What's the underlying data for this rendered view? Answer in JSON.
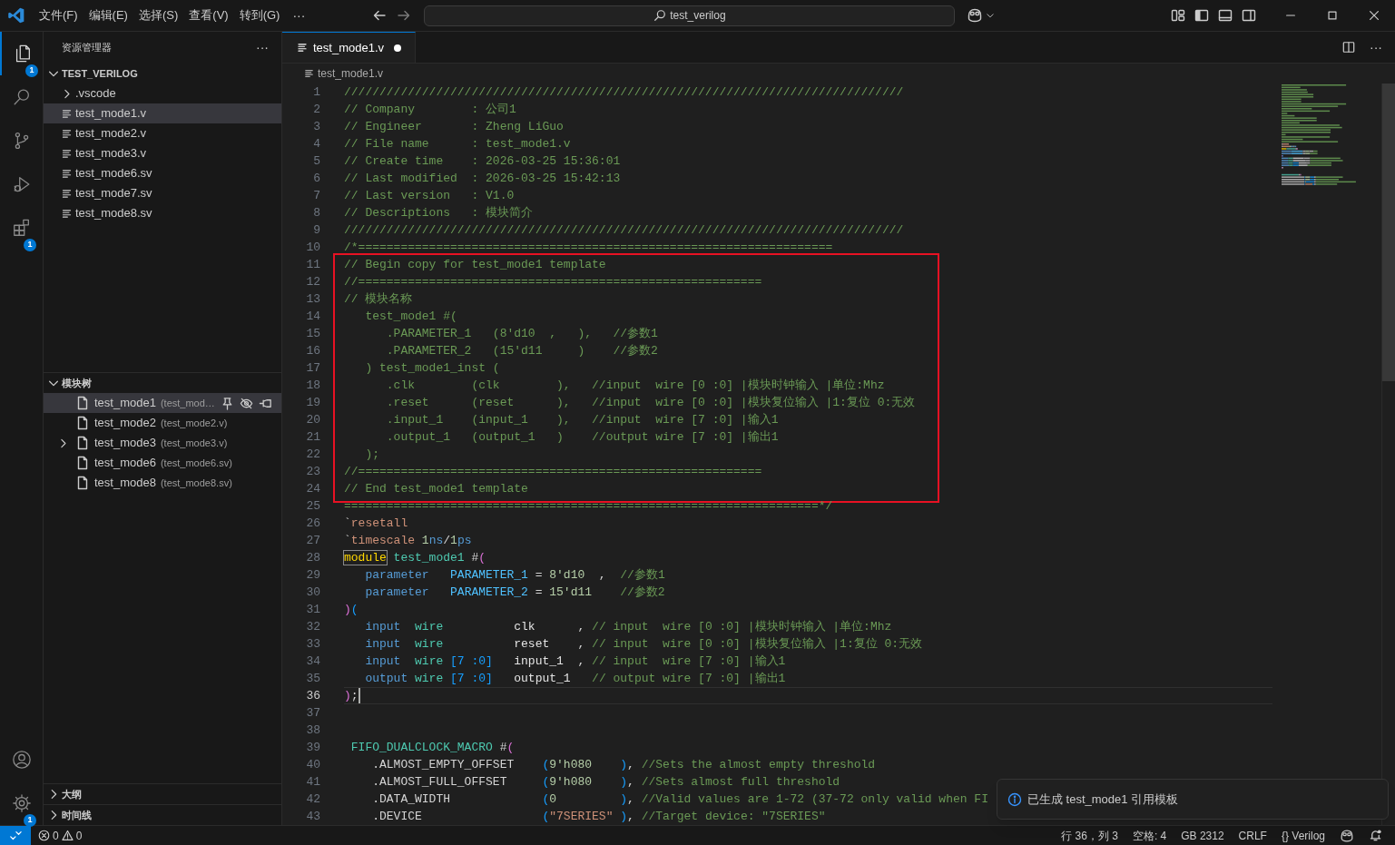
{
  "title_bar": {
    "menus": [
      {
        "label": "文件(F)"
      },
      {
        "label": "编辑(E)"
      },
      {
        "label": "选择(S)"
      },
      {
        "label": "查看(V)"
      },
      {
        "label": "转到(G)"
      }
    ],
    "overflow": "···",
    "search": {
      "value": "test_verilog"
    }
  },
  "activity_bar": {
    "items": [
      {
        "kind": "explorer",
        "selected": true,
        "badge": "1"
      },
      {
        "kind": "search",
        "selected": false
      },
      {
        "kind": "source-control",
        "selected": false
      },
      {
        "kind": "run-debug",
        "selected": false
      },
      {
        "kind": "extensions",
        "selected": false,
        "badge": "1"
      }
    ],
    "bottom": [
      {
        "kind": "account"
      },
      {
        "kind": "settings",
        "badge": "1"
      }
    ]
  },
  "explorer": {
    "title": "资源管理器",
    "overflow": "···",
    "folder": {
      "name": "TEST_VERILOG",
      "expanded": true,
      "children": [
        {
          "kind": "folder",
          "name": ".vscode",
          "expanded": false,
          "selected": false
        },
        {
          "kind": "file",
          "name": "test_mode1.v",
          "selected": true
        },
        {
          "kind": "file",
          "name": "test_mode2.v",
          "selected": false
        },
        {
          "kind": "file",
          "name": "test_mode3.v",
          "selected": false
        },
        {
          "kind": "file",
          "name": "test_mode6.sv",
          "selected": false
        },
        {
          "kind": "file",
          "name": "test_mode7.sv",
          "selected": false
        },
        {
          "kind": "file",
          "name": "test_mode8.sv",
          "selected": false
        }
      ]
    }
  },
  "module_tree": {
    "title": "模块树",
    "expanded": true,
    "items": [
      {
        "name": "test_mode1",
        "file": "(test_mod…",
        "selected": true,
        "expandable": false
      },
      {
        "name": "test_mode2",
        "file": "(test_mode2.v)",
        "selected": false,
        "expandable": false
      },
      {
        "name": "test_mode3",
        "file": "(test_mode3.v)",
        "selected": false,
        "expandable": true
      },
      {
        "name": "test_mode6",
        "file": "(test_mode6.sv)",
        "selected": false,
        "expandable": false
      },
      {
        "name": "test_mode8",
        "file": "(test_mode8.sv)",
        "selected": false,
        "expandable": false
      }
    ]
  },
  "outline": {
    "title": "大纲",
    "expanded": false
  },
  "timeline": {
    "title": "时间线",
    "expanded": false
  },
  "editor": {
    "tabs": [
      {
        "label": "test_mode1.v",
        "selected": true,
        "dirty": true
      }
    ],
    "breadcrumb": "test_mode1.v",
    "blocks": [
      {
        "boxed": false,
        "lines": [
          {
            "number": "1",
            "current": false,
            "segments": [
              {
                "text": "///////////////////////////////////////////////////////////////////////////////",
                "kind": "comment"
              }
            ]
          },
          {
            "number": "2",
            "current": false,
            "segments": [
              {
                "text": "// Company        : 公司1",
                "kind": "comment"
              }
            ]
          },
          {
            "number": "3",
            "current": false,
            "segments": [
              {
                "text": "// Engineer       : Zheng LiGuo",
                "kind": "comment"
              }
            ]
          },
          {
            "number": "4",
            "current": false,
            "segments": [
              {
                "text": "// File name      : test_mode1.v",
                "kind": "comment"
              }
            ]
          },
          {
            "number": "5",
            "current": false,
            "segments": [
              {
                "text": "// Create time    : 2026-03-25 15:36:01",
                "kind": "comment"
              }
            ]
          },
          {
            "number": "6",
            "current": false,
            "segments": [
              {
                "text": "// Last modified  : 2026-03-25 15:42:13",
                "kind": "comment"
              }
            ]
          },
          {
            "number": "7",
            "current": false,
            "segments": [
              {
                "text": "// Last version   : V1.0",
                "kind": "comment"
              }
            ]
          },
          {
            "number": "8",
            "current": false,
            "segments": [
              {
                "text": "// Descriptions   : 模块简介",
                "kind": "comment"
              }
            ]
          },
          {
            "number": "9",
            "current": false,
            "segments": [
              {
                "text": "///////////////////////////////////////////////////////////////////////////////",
                "kind": "comment"
              }
            ]
          },
          {
            "number": "10",
            "current": false,
            "segments": [
              {
                "text": "/*===================================================================",
                "kind": "comment"
              }
            ]
          }
        ]
      },
      {
        "boxed": true,
        "lines": [
          {
            "number": "11",
            "current": false,
            "segments": [
              {
                "text": "// Begin copy for test_mode1 template",
                "kind": "comment"
              }
            ]
          },
          {
            "number": "12",
            "current": false,
            "segments": [
              {
                "text": "//=========================================================",
                "kind": "comment"
              }
            ]
          },
          {
            "number": "13",
            "current": false,
            "segments": [
              {
                "text": "// 模块名称",
                "kind": "comment"
              }
            ]
          },
          {
            "number": "14",
            "current": false,
            "segments": [
              {
                "text": "   test_mode1 #(",
                "kind": "comment"
              }
            ]
          },
          {
            "number": "15",
            "current": false,
            "segments": [
              {
                "text": "      .PARAMETER_1   (8'd10  ,   ),   //参数1",
                "kind": "comment"
              }
            ]
          },
          {
            "number": "16",
            "current": false,
            "segments": [
              {
                "text": "      .PARAMETER_2   (15'd11     )    //参数2",
                "kind": "comment"
              }
            ]
          },
          {
            "number": "17",
            "current": false,
            "segments": [
              {
                "text": "   ) test_mode1_inst (",
                "kind": "comment"
              }
            ]
          },
          {
            "number": "18",
            "current": false,
            "segments": [
              {
                "text": "      .clk        (clk        ),   //input  wire [0 :0] |模块时钟输入 |单位:Mhz",
                "kind": "comment"
              }
            ]
          },
          {
            "number": "19",
            "current": false,
            "segments": [
              {
                "text": "      .reset      (reset      ),   //input  wire [0 :0] |模块复位输入 |1:复位 0:无效",
                "kind": "comment"
              }
            ]
          },
          {
            "number": "20",
            "current": false,
            "segments": [
              {
                "text": "      .input_1    (input_1    ),   //input  wire [7 :0] |输入1",
                "kind": "comment"
              }
            ]
          },
          {
            "number": "21",
            "current": false,
            "segments": [
              {
                "text": "      .output_1   (output_1   )    //output wire [7 :0] |输出1",
                "kind": "comment"
              }
            ]
          },
          {
            "number": "22",
            "current": false,
            "segments": [
              {
                "text": "   );",
                "kind": "comment"
              }
            ]
          },
          {
            "number": "23",
            "current": false,
            "segments": [
              {
                "text": "//=========================================================",
                "kind": "comment"
              }
            ]
          },
          {
            "number": "24",
            "current": false,
            "segments": [
              {
                "text": "// End test_mode1 template",
                "kind": "comment"
              }
            ]
          }
        ]
      },
      {
        "boxed": false,
        "lines": [
          {
            "number": "25",
            "current": false,
            "segments": [
              {
                "text": "===================================================================*/",
                "kind": "comment"
              }
            ]
          },
          {
            "number": "26",
            "current": false,
            "segments": [
              {
                "text": "`",
                "kind": "plain"
              },
              {
                "text": "resetall",
                "kind": "directive"
              }
            ]
          },
          {
            "number": "27",
            "current": false,
            "segments": [
              {
                "text": "`",
                "kind": "plain"
              },
              {
                "text": "timescale",
                "kind": "directive"
              },
              {
                "text": " 1",
                "kind": "number"
              },
              {
                "text": "ns",
                "kind": "keyword"
              },
              {
                "text": "/",
                "kind": "plain"
              },
              {
                "text": "1",
                "kind": "number"
              },
              {
                "text": "ps",
                "kind": "keyword"
              }
            ]
          },
          {
            "number": "28",
            "current": false,
            "segments": [
              {
                "text": "module",
                "kind": "matched"
              },
              {
                "text": " test_mode1",
                "kind": "type"
              },
              {
                "text": " #",
                "kind": "plain"
              },
              {
                "text": "(",
                "kind": "bracket-pink"
              }
            ]
          },
          {
            "number": "29",
            "current": false,
            "segments": [
              {
                "text": "   parameter",
                "kind": "keyword"
              },
              {
                "text": "   PARAMETER_1",
                "kind": "constant"
              },
              {
                "text": " = ",
                "kind": "plain"
              },
              {
                "text": "8'd10",
                "kind": "number"
              },
              {
                "text": "  ,  ",
                "kind": "plain"
              },
              {
                "text": "//参数1",
                "kind": "comment"
              }
            ]
          },
          {
            "number": "30",
            "current": false,
            "segments": [
              {
                "text": "   parameter",
                "kind": "keyword"
              },
              {
                "text": "   PARAMETER_2",
                "kind": "constant"
              },
              {
                "text": " = ",
                "kind": "plain"
              },
              {
                "text": "15'd11",
                "kind": "number"
              },
              {
                "text": "    //参数2",
                "kind": "comment"
              }
            ]
          },
          {
            "number": "31",
            "current": false,
            "segments": [
              {
                "text": ")",
                "kind": "bracket-pink"
              },
              {
                "text": "(",
                "kind": "bracket-blue"
              }
            ]
          },
          {
            "number": "32",
            "current": false,
            "segments": [
              {
                "text": "   input",
                "kind": "keyword"
              },
              {
                "text": "  wire",
                "kind": "type"
              },
              {
                "text": "          clk",
                "kind": "identifier"
              },
              {
                "text": "      , ",
                "kind": "plain"
              },
              {
                "text": "// input  wire [0 :0] |模块时钟输入 |单位:Mhz",
                "kind": "comment"
              }
            ]
          },
          {
            "number": "33",
            "current": false,
            "segments": [
              {
                "text": "   input",
                "kind": "keyword"
              },
              {
                "text": "  wire",
                "kind": "type"
              },
              {
                "text": "          reset",
                "kind": "identifier"
              },
              {
                "text": "    , ",
                "kind": "plain"
              },
              {
                "text": "// input  wire [0 :0] |模块复位输入 |1:复位 0:无效",
                "kind": "comment"
              }
            ]
          },
          {
            "number": "34",
            "current": false,
            "segments": [
              {
                "text": "   input",
                "kind": "keyword"
              },
              {
                "text": "  wire",
                "kind": "type"
              },
              {
                "text": " [7 :0]",
                "kind": "bracket-blue"
              },
              {
                "text": "   input_1",
                "kind": "identifier"
              },
              {
                "text": "  , ",
                "kind": "plain"
              },
              {
                "text": "// input  wire [7 :0] |输入1",
                "kind": "comment"
              }
            ]
          },
          {
            "number": "35",
            "current": false,
            "segments": [
              {
                "text": "   output",
                "kind": "keyword"
              },
              {
                "text": " wire",
                "kind": "type"
              },
              {
                "text": " [7 :0]",
                "kind": "bracket-blue"
              },
              {
                "text": "   output_1",
                "kind": "identifier"
              },
              {
                "text": "   // output wire [7 :0] |输出1",
                "kind": "comment"
              }
            ]
          },
          {
            "number": "36",
            "current": true,
            "segments": [
              {
                "text": ")",
                "kind": "bracket-pink"
              },
              {
                "text": ";",
                "kind": "plain"
              }
            ]
          },
          {
            "number": "37",
            "current": false
          },
          {
            "number": "38",
            "current": false
          },
          {
            "number": "39",
            "current": false,
            "segments": [
              {
                "text": " FIFO_DUALCLOCK_MACRO",
                "kind": "type"
              },
              {
                "text": " #",
                "kind": "plain"
              },
              {
                "text": "(",
                "kind": "bracket-pink"
              }
            ]
          },
          {
            "number": "40",
            "current": false,
            "segments": [
              {
                "text": "    .ALMOST_EMPTY_OFFSET    ",
                "kind": "plain"
              },
              {
                "text": "(",
                "kind": "bracket-blue"
              },
              {
                "text": "9'h080",
                "kind": "number"
              },
              {
                "text": "    )",
                "kind": "bracket-blue"
              },
              {
                "text": ", ",
                "kind": "plain"
              },
              {
                "text": "//Sets the almost empty threshold",
                "kind": "comment"
              }
            ]
          },
          {
            "number": "41",
            "current": false,
            "segments": [
              {
                "text": "    .ALMOST_FULL_OFFSET     ",
                "kind": "plain"
              },
              {
                "text": "(",
                "kind": "bracket-blue"
              },
              {
                "text": "9'h080",
                "kind": "number"
              },
              {
                "text": "    )",
                "kind": "bracket-blue"
              },
              {
                "text": ", ",
                "kind": "plain"
              },
              {
                "text": "//Sets almost full threshold",
                "kind": "comment"
              }
            ]
          },
          {
            "number": "42",
            "current": false,
            "segments": [
              {
                "text": "    .DATA_WIDTH             ",
                "kind": "plain"
              },
              {
                "text": "(",
                "kind": "bracket-blue"
              },
              {
                "text": "0",
                "kind": "number"
              },
              {
                "text": "         )",
                "kind": "bracket-blue"
              },
              {
                "text": ", ",
                "kind": "plain"
              },
              {
                "text": "//Valid values are 1-72 (37-72 only valid when FI",
                "kind": "comment"
              }
            ]
          },
          {
            "number": "43",
            "current": false,
            "segments": [
              {
                "text": "    .DEVICE                 ",
                "kind": "plain"
              },
              {
                "text": "(",
                "kind": "bracket-blue"
              },
              {
                "text": "\"7SERIES\"",
                "kind": "string"
              },
              {
                "text": " )",
                "kind": "bracket-blue"
              },
              {
                "text": ", ",
                "kind": "plain"
              },
              {
                "text": "//Target device: \"7SERIES\"",
                "kind": "comment"
              }
            ]
          }
        ]
      }
    ]
  },
  "notification": {
    "kind": "info",
    "message": "已生成 test_mode1 引用模板"
  },
  "status_bar": {
    "errors": "0",
    "warnings": "0",
    "items": [
      {
        "kind": "text",
        "text": "行 36，列 3"
      },
      {
        "kind": "text",
        "text": "空格: 4"
      },
      {
        "kind": "text",
        "text": "GB 2312"
      },
      {
        "kind": "text",
        "text": "CRLF"
      },
      {
        "kind": "text",
        "text": "{} Verilog"
      },
      {
        "kind": "robot"
      },
      {
        "kind": "bell"
      }
    ]
  }
}
